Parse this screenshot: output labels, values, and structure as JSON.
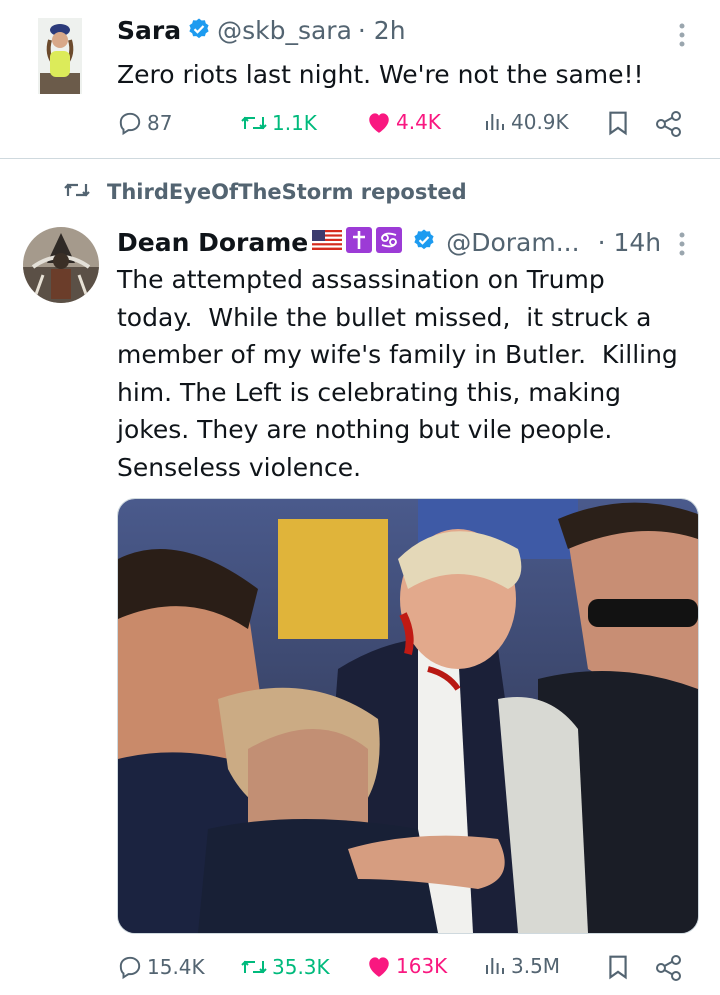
{
  "tweet1": {
    "name": "Sara",
    "handle": "@skb_sara",
    "time": "· 2h",
    "text": "Zero riots last night. We're not the same!!",
    "replies": "87",
    "reposts": "1.1K",
    "likes": "4.4K",
    "views": "40.9K"
  },
  "repost_banner": {
    "text": "ThirdEyeOfTheStorm reposted"
  },
  "tweet2": {
    "name": "Dean Dorame",
    "handle": "@Doram...",
    "time": "· 14h",
    "text_lines": [
      "The attempted assassination on Trump",
      "today.  While the bullet missed,  it struck a",
      "member of my wife's family in Butler.  Killing",
      "him. The Left is celebrating this, making",
      "jokes. They are nothing but vile people.",
      "Senseless violence."
    ],
    "replies": "15.4K",
    "reposts": "35.3K",
    "likes": "163K",
    "views": "3.5M"
  },
  "colors": {
    "verified": "#1d9bf0",
    "repost_green": "#00ba7c",
    "like_pink": "#f91880",
    "muted": "#536471",
    "divider": "#cfd9de"
  },
  "icons": [
    "verified-icon",
    "reply-icon",
    "repost-icon",
    "like-icon",
    "views-icon",
    "bookmark-icon",
    "share-icon",
    "more-icon",
    "us-flag-icon",
    "cross-icon",
    "cancer-sign-icon"
  ]
}
